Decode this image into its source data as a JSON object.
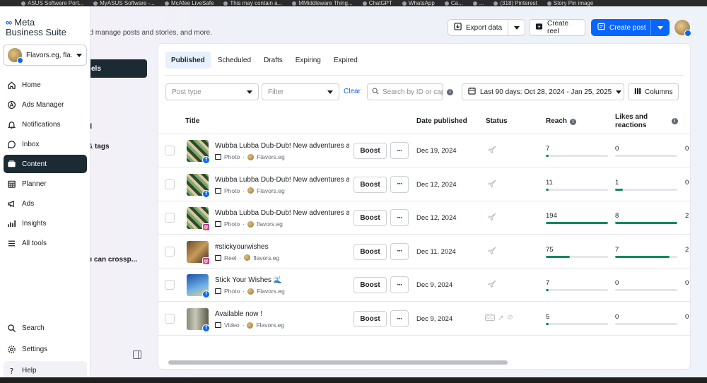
{
  "bookmarks": [
    "ASUS Software Port...",
    "MyASUS Software -...",
    "McAfee LiveSafe",
    "This may contain a...",
    "MMiddleware Thing...",
    "ChatGPT",
    "WhatsApp",
    "Ca...",
    "...",
    "(318) Pinterest",
    "Story Pin image"
  ],
  "app": {
    "brand_line1": "Meta",
    "brand_line2": "Business Suite",
    "header_subtitle": "nd manage posts and stories, and more."
  },
  "account": {
    "name": "Flavors.eg, fla..."
  },
  "nav": {
    "items": [
      {
        "label": "Home",
        "icon": "home-icon"
      },
      {
        "label": "Ads Manager",
        "icon": "ads-manager-icon"
      },
      {
        "label": "Notifications",
        "icon": "bell-icon"
      },
      {
        "label": "Inbox",
        "icon": "inbox-icon"
      },
      {
        "label": "Content",
        "icon": "content-icon"
      },
      {
        "label": "Planner",
        "icon": "calendar-icon"
      },
      {
        "label": "Ads",
        "icon": "megaphone-icon"
      },
      {
        "label": "Insights",
        "icon": "insights-icon"
      },
      {
        "label": "All tools",
        "icon": "menu-icon"
      }
    ],
    "bottom": [
      {
        "label": "Search",
        "icon": "search-icon"
      },
      {
        "label": "Settings",
        "icon": "gear-icon"
      },
      {
        "label": "Help",
        "icon": "help-icon"
      }
    ]
  },
  "behind": {
    "panel": "els",
    "item1": "d",
    "item2": "& tags",
    "item3": "u can crossp..."
  },
  "header": {
    "export_label": "Export data",
    "create_reel_label": "Create reel",
    "create_post_label": "Create post"
  },
  "tabs": [
    "Published",
    "Scheduled",
    "Drafts",
    "Expiring",
    "Expired"
  ],
  "filters": {
    "post_type_placeholder": "Post type",
    "filter_placeholder": "Filter",
    "clear_label": "Clear",
    "search_placeholder": "Search by ID or cap",
    "date_range": "Last 90 days: Oct 28, 2024 - Jan 25, 2025",
    "columns_label": "Columns"
  },
  "columns": {
    "title": "Title",
    "date": "Date published",
    "status": "Status",
    "reach": "Reach",
    "likes_line1": "Likes and",
    "likes_line2": "reactions"
  },
  "rows": [
    {
      "title": "Wubba Lubba Dub-Dub! New adventures aw...",
      "type": "Photo",
      "account": "Flavors.eg",
      "platform": "facebook",
      "boost": "Boost",
      "date": "Dec 19, 2024",
      "reach": "7",
      "likes": "0",
      "next": "0",
      "reach_fill": 0.02,
      "likes_fill": 0.0
    },
    {
      "title": "Wubba Lubba Dub-Dub! New adventures aw...",
      "type": "Photo",
      "account": "Flavors.eg",
      "platform": "facebook",
      "boost": "Boost",
      "date": "Dec 12, 2024",
      "reach": "11",
      "likes": "1",
      "next": "0",
      "reach_fill": 0.05,
      "likes_fill": 0.12
    },
    {
      "title": "Wubba Lubba Dub-Dub! New adventures aw...",
      "type": "Photo",
      "account": "flavors.eg",
      "platform": "instagram",
      "boost": "Boost",
      "date": "Dec 12, 2024",
      "reach": "194",
      "likes": "8",
      "next": "2",
      "reach_fill": 1.0,
      "likes_fill": 1.0
    },
    {
      "title": "#stickyourwishes",
      "type": "Reel",
      "account": "flavors.eg",
      "platform": "instagram",
      "boost": "Boost",
      "date": "Dec 11, 2024",
      "reach": "75",
      "likes": "7",
      "next": "2",
      "reach_fill": 0.39,
      "likes_fill": 0.88
    },
    {
      "title": "Stick Your Wishes 🌊",
      "type": "Photo",
      "account": "Flavors.eg",
      "platform": "facebook",
      "boost": "Boost",
      "date": "Dec 9, 2024",
      "reach": "7",
      "likes": "0",
      "next": "0",
      "reach_fill": 0.02,
      "likes_fill": 0.0
    },
    {
      "title": "Available now !",
      "type": "Video",
      "account": "Flavors.eg",
      "platform": "facebook",
      "boost": "Boost",
      "date": "Dec 9, 2024",
      "reach": "5",
      "likes": "0",
      "next": "0",
      "reach_fill": 0.02,
      "likes_fill": 0.0
    }
  ],
  "colors": {
    "primary": "#0866ff",
    "active_nav": "#1c2b33",
    "reach_bar": "#108a5a"
  }
}
